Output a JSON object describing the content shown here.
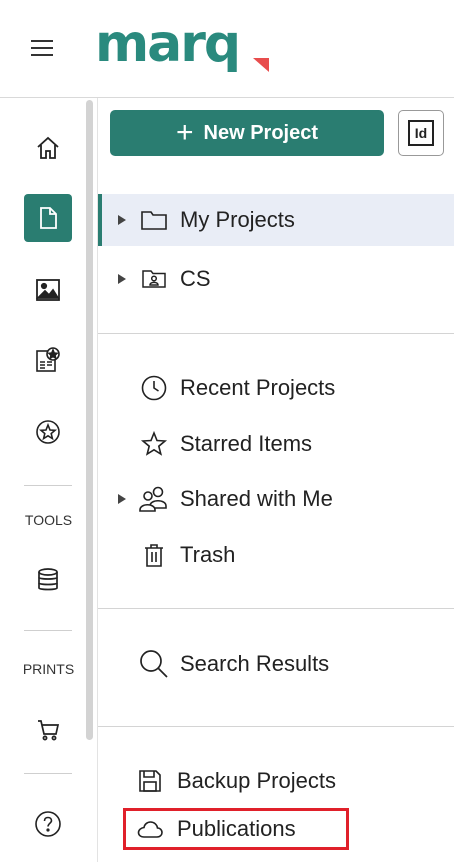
{
  "app": {
    "logo_text": "marq",
    "brand_color": "#2a7d71",
    "accent_color": "#e84d4d"
  },
  "rail": {
    "items": [
      {
        "name": "home-icon",
        "active": false
      },
      {
        "name": "document-icon",
        "active": true
      },
      {
        "name": "image-icon",
        "active": false
      },
      {
        "name": "template-star-icon",
        "active": false
      },
      {
        "name": "star-circle-icon",
        "active": false
      }
    ],
    "tools_label": "TOOLS",
    "tools_icon": "database-icon",
    "prints_label": "PRINTS",
    "prints_icon": "cart-icon",
    "help_icon": "help-icon"
  },
  "toolbar": {
    "new_project_label": "New Project",
    "id_button_label": "Id"
  },
  "tree": {
    "folders": [
      {
        "label": "My Projects",
        "icon": "folder-icon",
        "expandable": true,
        "selected": true
      },
      {
        "label": "CS",
        "icon": "shared-folder-icon",
        "expandable": true,
        "selected": false
      }
    ],
    "views": [
      {
        "label": "Recent Projects",
        "icon": "clock-icon",
        "expandable": false
      },
      {
        "label": "Starred Items",
        "icon": "star-icon",
        "expandable": false
      },
      {
        "label": "Shared with Me",
        "icon": "users-icon",
        "expandable": true
      },
      {
        "label": "Trash",
        "icon": "trash-icon",
        "expandable": false
      }
    ],
    "search_label": "Search Results",
    "backup_label": "Backup Projects",
    "publications_label": "Publications"
  }
}
